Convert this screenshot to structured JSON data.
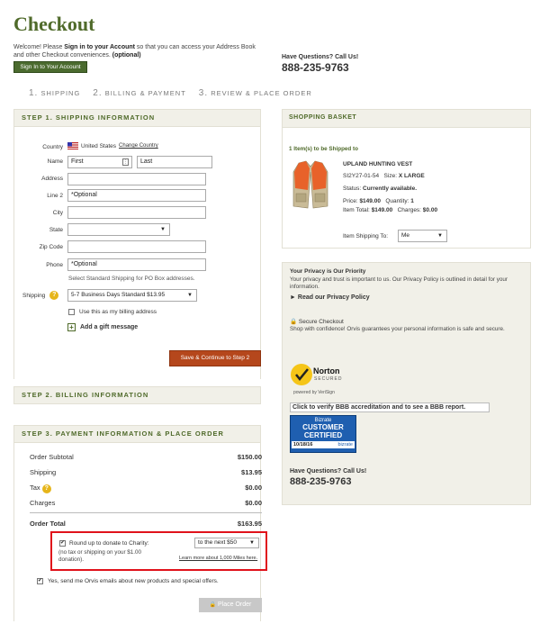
{
  "page": {
    "title": "Checkout"
  },
  "welcome": {
    "pre": "Welcome! Please ",
    "link": "Sign in to your Account",
    "post": " so that you can access your Address Book and other Checkout conveniences. ",
    "optional": "(optional)",
    "signin_button": "Sign In to Your Account"
  },
  "steps": [
    {
      "num": "1.",
      "label": "SHIPPING"
    },
    {
      "num": "2.",
      "label": "BILLING & PAYMENT"
    },
    {
      "num": "3.",
      "label": "REVIEW & PLACE ORDER"
    }
  ],
  "step1": {
    "title": "STEP 1. SHIPPING INFORMATION",
    "country_label": "Country",
    "country_value": "United States",
    "change_country": "Change Country",
    "name_label": "Name",
    "first_value": "First",
    "last_value": "Last",
    "address_label": "Address",
    "line2_label": "Line 2",
    "line2_placeholder": "*Optional",
    "city_label": "City",
    "state_label": "State",
    "zip_label": "Zip Code",
    "phone_label": "Phone",
    "phone_placeholder": "*Optional",
    "po_note": "Select Standard Shipping for PO Box addresses.",
    "shipping_label": "Shipping",
    "shipping_value": "5-7 Business Days Standard $13.95",
    "billing_check": "Use this as my billing address",
    "gift_message": "Add a gift message",
    "continue_button": "Save & Continue to Step 2"
  },
  "step2": {
    "title": "STEP 2. BILLING INFORMATION"
  },
  "step3": {
    "title": "STEP 3. PAYMENT INFORMATION & PLACE ORDER",
    "rows": [
      {
        "label": "Order Subtotal",
        "value": "$150.00"
      },
      {
        "label": "Shipping",
        "value": "$13.95"
      },
      {
        "label": "Tax",
        "value": "$0.00"
      },
      {
        "label": "Charges",
        "value": "$0.00"
      }
    ],
    "total_label": "Order Total",
    "total_value": "$163.95",
    "donate_label": "Round up to donate to Charity:",
    "donate_note": "(no tax or shipping on your $1.00 donation).",
    "donate_select": "to the next $50",
    "donate_link": "Learn more about 1,000 Miles here.",
    "email_opt": "Yes, send me Orvis emails about new products and special offers.",
    "place_order": "Place Order"
  },
  "right": {
    "questions": "Have Questions? Call Us!",
    "phone": "888-235-9763",
    "basket_title": "SHOPPING BASKET",
    "items_shipped": "1 Item(s) to be Shipped to",
    "product_name": "UPLAND HUNTING VEST",
    "sku": "SI2Y27-01-54",
    "size_label": "Size:",
    "size_value": "X LARGE",
    "status_label": "Status:",
    "status_value": "Currently available.",
    "price_label": "Price:",
    "price_value": "$149.00",
    "qty_label": "Quantity:",
    "qty_value": "1",
    "item_total_label": "Item Total:",
    "item_total_value": "$149.00",
    "charges_label": "Charges:",
    "charges_value": "$0.00",
    "ship_to_label": "Item Shipping To:",
    "ship_to_value": "Me",
    "privacy_title": "Your Privacy is Our Priority",
    "privacy_text": "Your privacy and trust is important to us. Our Privacy Policy is outlined in detail for your information.",
    "privacy_link": "Read our Privacy Policy",
    "secure_title": "Secure Checkout",
    "secure_text": "Shop with confidence! Orvis guarantees your personal information is safe and secure.",
    "norton_name": "Norton",
    "norton_secured": "SECURED",
    "norton_powered": "powered by VeriSign",
    "bbb_text": "Click to verify BBB accreditation and to see a BBB report.",
    "bizrate_top": "Bizrate",
    "bizrate_main1": "CUSTOMER",
    "bizrate_main2": "CERTIFIED",
    "bizrate_date": "10/18/16",
    "bizrate_brand": "bizrate",
    "questions2": "Have Questions? Call Us!",
    "phone2": "888-235-9763"
  },
  "colors": {
    "brand_green": "#4f6a2a",
    "orange": "#b5471c",
    "highlight_red": "#e0121b",
    "panel_gray": "#f1f0e8"
  }
}
